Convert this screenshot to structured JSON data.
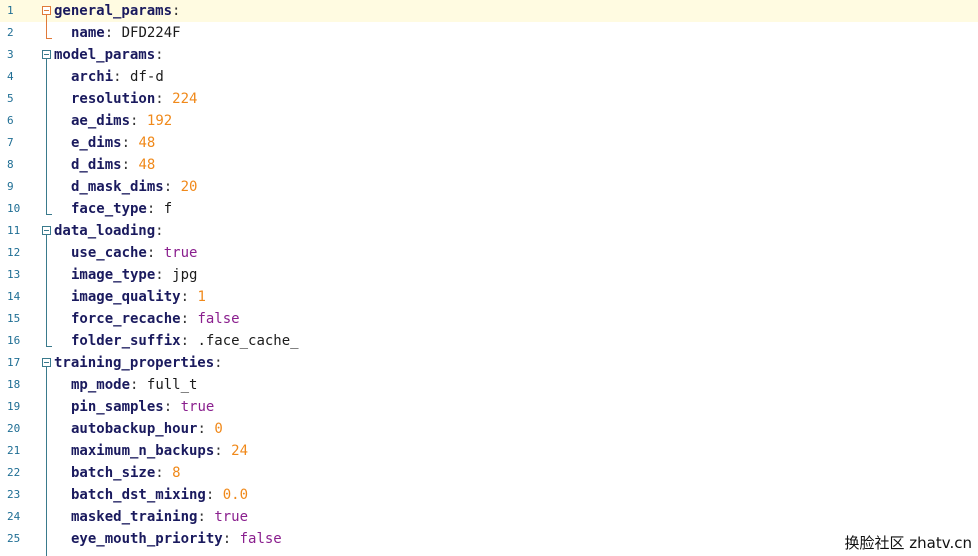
{
  "editor": {
    "lines": [
      {
        "num": "1",
        "key": "general_params",
        "value": null,
        "type": "section"
      },
      {
        "num": "2",
        "key": "name",
        "value": "DFD224F",
        "type": "str"
      },
      {
        "num": "3",
        "key": "model_params",
        "value": null,
        "type": "section"
      },
      {
        "num": "4",
        "key": "archi",
        "value": "df-d",
        "type": "str"
      },
      {
        "num": "5",
        "key": "resolution",
        "value": "224",
        "type": "num"
      },
      {
        "num": "6",
        "key": "ae_dims",
        "value": "192",
        "type": "num"
      },
      {
        "num": "7",
        "key": "e_dims",
        "value": "48",
        "type": "num"
      },
      {
        "num": "8",
        "key": "d_dims",
        "value": "48",
        "type": "num"
      },
      {
        "num": "9",
        "key": "d_mask_dims",
        "value": "20",
        "type": "num"
      },
      {
        "num": "10",
        "key": "face_type",
        "value": "f",
        "type": "str"
      },
      {
        "num": "11",
        "key": "data_loading",
        "value": null,
        "type": "section"
      },
      {
        "num": "12",
        "key": "use_cache",
        "value": "true",
        "type": "bool"
      },
      {
        "num": "13",
        "key": "image_type",
        "value": "jpg",
        "type": "str"
      },
      {
        "num": "14",
        "key": "image_quality",
        "value": "1",
        "type": "num"
      },
      {
        "num": "15",
        "key": "force_recache",
        "value": "false",
        "type": "bool"
      },
      {
        "num": "16",
        "key": "folder_suffix",
        "value": ".face_cache_",
        "type": "str"
      },
      {
        "num": "17",
        "key": "training_properties",
        "value": null,
        "type": "section"
      },
      {
        "num": "18",
        "key": "mp_mode",
        "value": "full_t",
        "type": "str"
      },
      {
        "num": "19",
        "key": "pin_samples",
        "value": "true",
        "type": "bool"
      },
      {
        "num": "20",
        "key": "autobackup_hour",
        "value": "0",
        "type": "num"
      },
      {
        "num": "21",
        "key": "maximum_n_backups",
        "value": "24",
        "type": "num"
      },
      {
        "num": "22",
        "key": "batch_size",
        "value": "8",
        "type": "num"
      },
      {
        "num": "23",
        "key": "batch_dst_mixing",
        "value": "0.0",
        "type": "num"
      },
      {
        "num": "24",
        "key": "masked_training",
        "value": "true",
        "type": "bool"
      },
      {
        "num": "25",
        "key": "eye_mouth_priority",
        "value": "false",
        "type": "bool"
      }
    ],
    "colors": {
      "current_line": "#fffbe1",
      "line_number": "#1f6e94",
      "key": "#1a1a5e",
      "number": "#f0891a",
      "boolean": "#8a1f8e",
      "fold_active": "#e07a3a",
      "fold": "#3a7a8c"
    }
  },
  "watermark": "换脸社区 zhatv.cn"
}
